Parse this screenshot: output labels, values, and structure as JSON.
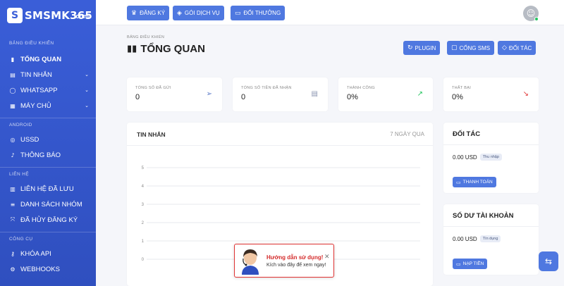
{
  "brand": {
    "badge": "S",
    "name": "SMSMK365",
    "tld": ".com"
  },
  "sidebar": {
    "section_dashboard": "BẢNG ĐIỀU KHIỂN",
    "overview": "TỔNG QUAN",
    "messages": "TIN NHẮN",
    "whatsapp": "WHATSAPP",
    "server": "MÁY CHỦ",
    "section_android": "ANDROID",
    "ussd": "USSD",
    "notifications": "THÔNG BÁO",
    "section_contacts": "LIÊN HỆ",
    "saved_contacts": "LIÊN HỆ ĐÃ LƯU",
    "group_list": "DANH SÁCH NHÓM",
    "unsubscribed": "ĐÃ HỦY ĐĂNG KÝ",
    "section_tools": "CÔNG CỤ",
    "api_key": "KHÓA API",
    "webhooks": "WEBHOOKS"
  },
  "topbar": {
    "subscribe": "ĐĂNG KÝ",
    "packages": "GÓI DỊCH VỤ",
    "rewards": "ĐỔI THƯỞNG"
  },
  "header": {
    "breadcrumb": "BẢNG ĐIỀU KHIỂN",
    "title": "TỔNG QUAN",
    "plugin": "PLUGIN",
    "sms_port": "CỔNG SMS",
    "partner": "ĐỐI TÁC"
  },
  "stats": {
    "sent_label": "TỔNG SỐ ĐÃ GỬI",
    "sent_value": "0",
    "received_label": "TỔNG SỐ TIỀN ĐÃ NHẬN",
    "received_value": "0",
    "success_label": "THÀNH CÔNG",
    "success_value": "0%",
    "failed_label": "THẤT BẠI",
    "failed_value": "0%"
  },
  "messages_card": {
    "title": "TIN NHẮN",
    "period": "7 NGÀY QUA"
  },
  "chart_data": {
    "type": "line",
    "y_ticks": [
      "5",
      "4",
      "3",
      "2",
      "1",
      "0"
    ],
    "ylim": [
      0,
      5
    ],
    "series": [],
    "grid": true
  },
  "partner_card": {
    "title": "ĐỐI TÁC",
    "amount": "0.00 USD",
    "tag": "Thu nhập",
    "button": "THANH TOÁN"
  },
  "balance_card": {
    "title": "SỐ DƯ TÀI KHOẢN",
    "amount": "0.00 USD",
    "tag": "Tín dụng",
    "button": "NẠP TIỀN"
  },
  "help": {
    "title": "Hướng dẫn sử dụng!",
    "subtitle": "Kích vào đây để xem ngay!",
    "close": "✕"
  },
  "colors": {
    "primary": "#4f78e0",
    "sidebar": "#3a5ed8",
    "success": "#22c55e",
    "danger": "#e03333"
  }
}
